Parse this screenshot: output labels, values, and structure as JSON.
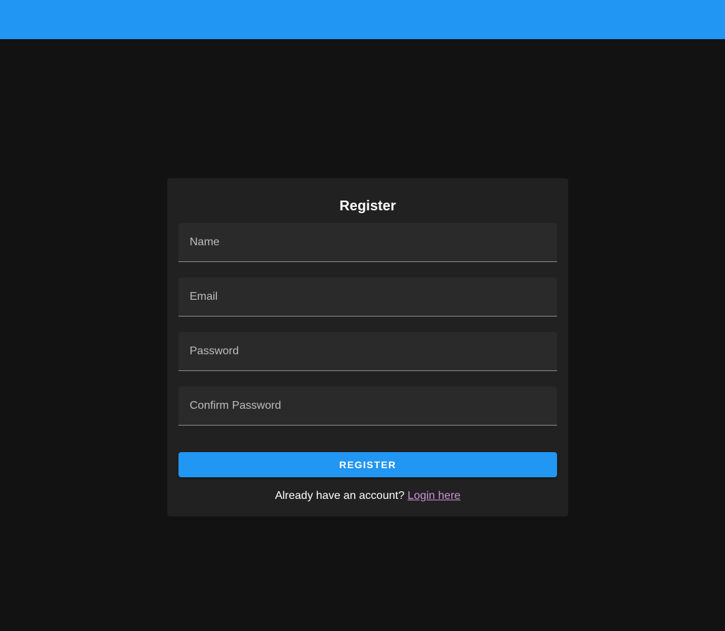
{
  "colors": {
    "accent": "#2196f3",
    "background": "#121212",
    "card": "#212121",
    "field": "#2a2a2a",
    "link": "#ce93d8"
  },
  "form": {
    "title": "Register",
    "fields": {
      "name": {
        "placeholder": "Name",
        "value": ""
      },
      "email": {
        "placeholder": "Email",
        "value": ""
      },
      "password": {
        "placeholder": "Password",
        "value": ""
      },
      "confirm_password": {
        "placeholder": "Confirm Password",
        "value": ""
      }
    },
    "submit_label": "Register",
    "login_prompt": "Already have an account?",
    "login_link_label": "Login here"
  }
}
